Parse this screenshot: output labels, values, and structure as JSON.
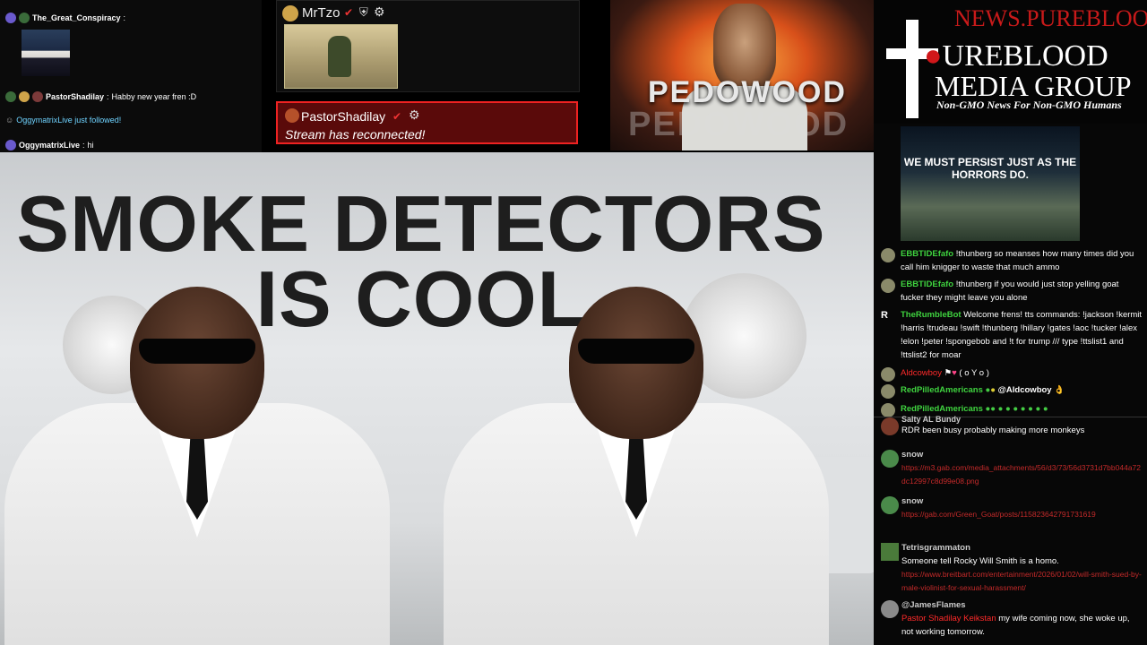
{
  "top_left_chat": {
    "items": [
      {
        "user": "The_Great_Conspiracy",
        "sep": ":"
      },
      {
        "user": "PastorShadilay",
        "sep": ":",
        "text": "Habby new year fren :D"
      },
      {
        "text": "OggymatrixLive just followed!"
      },
      {
        "user": "OggymatrixLive",
        "sep": ":",
        "text": "hi"
      }
    ]
  },
  "overlay": {
    "mrtzo_name": "MrTzo",
    "reconnect_name": "PastorShadilay",
    "reconnect_message": "Stream has reconnected!"
  },
  "promo_image": {
    "text": "PEDOWOOD"
  },
  "logo": {
    "site": "NEWS.PUREBLOOD.MEDIA",
    "line1": "UREBLOOD",
    "line2": "MEDIA GROUP",
    "tagline": "Non-GMO News For Non-GMO Humans"
  },
  "main_video": {
    "headline_line1": "SMOKE DETECTORS",
    "headline_line2": "IS COOL"
  },
  "side_chat": {
    "meme_text": "WE MUST PERSIST JUST AS THE HORRORS DO.",
    "messages": [
      {
        "user": "EBBTIDEfafo",
        "text": "!thunberg so meanses how many times did you call him knigger to waste that much ammo"
      },
      {
        "user": "EBBTIDEfafo",
        "text": "!thunberg if you would just stop yelling goat fucker they might leave you alone"
      },
      {
        "user": "TheRumbleBot",
        "text": "Welcome frens! tts commands: !jackson !kermit !harris !trudeau !swift !thunberg !hillary !gates !aoc !tucker !alex !elon !peter !spongebob and !t for trump /// type !ttslist1 and !ttslist2 for moar"
      },
      {
        "user": "Aldcowboy",
        "text": "( o Y o )"
      },
      {
        "user": "RedPilledAmericans",
        "text": "@Aldcowboy"
      },
      {
        "user": "RedPilledAmericans",
        "text": ""
      },
      {
        "user": "Salty AL Bundy",
        "text": "RDR been busy probably making more monkeys"
      },
      {
        "user": "snow",
        "text": "https://m3.gab.com/media_attachments/56/d3/73/56d3731d7bb044a72dc12997c8d99e08.png"
      },
      {
        "user": "snow",
        "text": "https://gab.com/Green_Goat/posts/115823642791731619"
      },
      {
        "user": "Tetrisgrammaton",
        "text": "Someone tell Rocky Will Smith is a homo.",
        "link": "https://www.breitbart.com/entertainment/2026/01/02/will-smith-sued-by-male-violinist-for-sexual-harassment/"
      },
      {
        "user": "@JamesFlames",
        "mention": "Pastor Shadilay Keikstan",
        "text": "my wife coming now, she woke up, not working tomorrow."
      }
    ]
  },
  "colors": {
    "alert_bg": "#5a0a0a",
    "alert_border": "#ee2222",
    "chat_user": "#3fd33f",
    "link": "#c42a2a",
    "follow": "#6fd3ff"
  }
}
